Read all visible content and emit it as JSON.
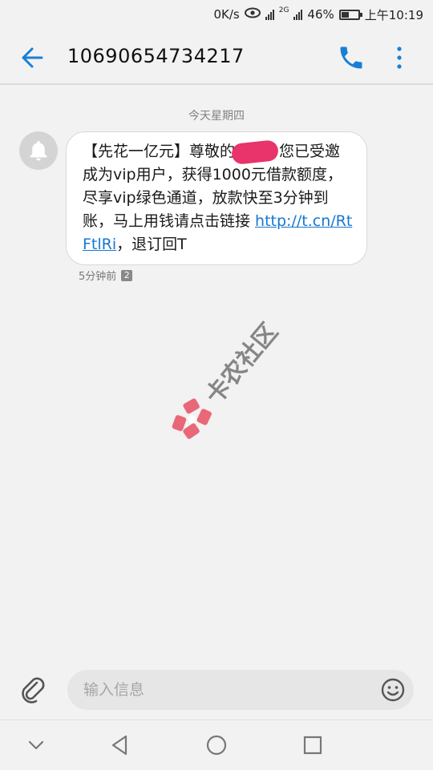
{
  "status": {
    "net_speed": "0K/s",
    "signal1_label": "",
    "signal2_label": "2G",
    "battery": "46%",
    "battery_level": 0.46,
    "time": "上午10:19"
  },
  "header": {
    "title": "10690654734217",
    "icons": [
      "back-arrow-icon",
      "phone-icon",
      "more-vert-icon"
    ]
  },
  "conversation": {
    "date_separator": "今天星期四",
    "message": {
      "text_before_redaction": "【先花一亿元】尊敬的",
      "text_after_redaction": "，您已受邀成为vip用户，获得1000元借款额度，尽享vip绿色通道，放款快至3分钟到账，马上用钱请点击链接 ",
      "link": "http://t.cn/RtFtlRi",
      "text_after_link": "，退订回T",
      "timestamp": "5分钟前",
      "sim_badge": "2"
    }
  },
  "watermark": {
    "text": "卡农社区"
  },
  "composer": {
    "placeholder": "输入信息"
  },
  "colors": {
    "accent": "#1a7fd4",
    "redaction": "#e8336b",
    "watermark_logo": "#e85a6a"
  }
}
